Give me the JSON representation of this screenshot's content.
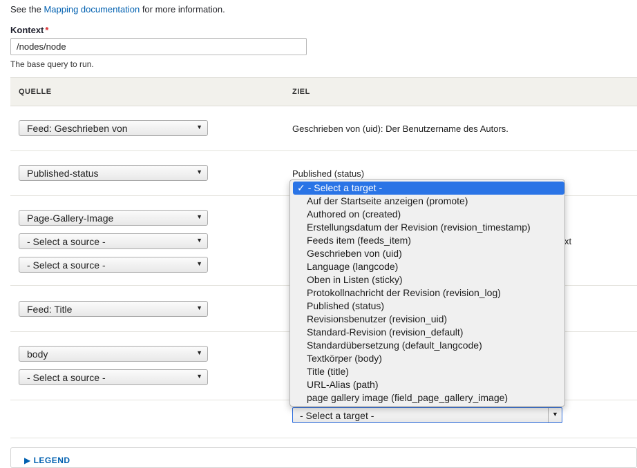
{
  "intro": {
    "prefix": "See the ",
    "link": "Mapping documentation",
    "suffix": " for more information."
  },
  "context": {
    "label": "Kontext",
    "required_mark": "*",
    "value": "/nodes/node",
    "help": "The base query to run."
  },
  "table": {
    "headers": {
      "source": "QUELLE",
      "target": "ZIEL"
    },
    "rows": [
      {
        "sources": [
          "Feed: Geschrieben von"
        ],
        "target": "Geschrieben von (uid): Der Benutzername des Autors."
      },
      {
        "sources": [
          "Published-status"
        ],
        "target": "Published (status)"
      },
      {
        "sources": [
          "Page-Gallery-Image",
          "- Select a source -",
          "- Select a source -"
        ],
        "target_peek": "xt"
      },
      {
        "sources": [
          "Feed: Title"
        ]
      },
      {
        "sources": [
          "body",
          "- Select a source -"
        ]
      },
      {
        "target_select": "- Select a target -"
      }
    ]
  },
  "dropdown": {
    "check": "✓",
    "options": [
      "- Select a target -",
      "Auf der Startseite anzeigen (promote)",
      "Authored on (created)",
      "Erstellungsdatum der Revision (revision_timestamp)",
      "Feeds item (feeds_item)",
      "Geschrieben von (uid)",
      "Language (langcode)",
      "Oben in Listen (sticky)",
      "Protokollnachricht der Revision (revision_log)",
      "Published (status)",
      "Revisionsbenutzer (revision_uid)",
      "Standard-Revision (revision_default)",
      "Standardübersetzung (default_langcode)",
      "Textkörper (body)",
      "Title (title)",
      "URL-Alias (path)",
      "page gallery image (field_page_gallery_image)"
    ]
  },
  "legend": "▶ LEGEND",
  "colors": {
    "link": "#0060b0",
    "required": "#d9272b",
    "selected": "#2a74e6"
  }
}
